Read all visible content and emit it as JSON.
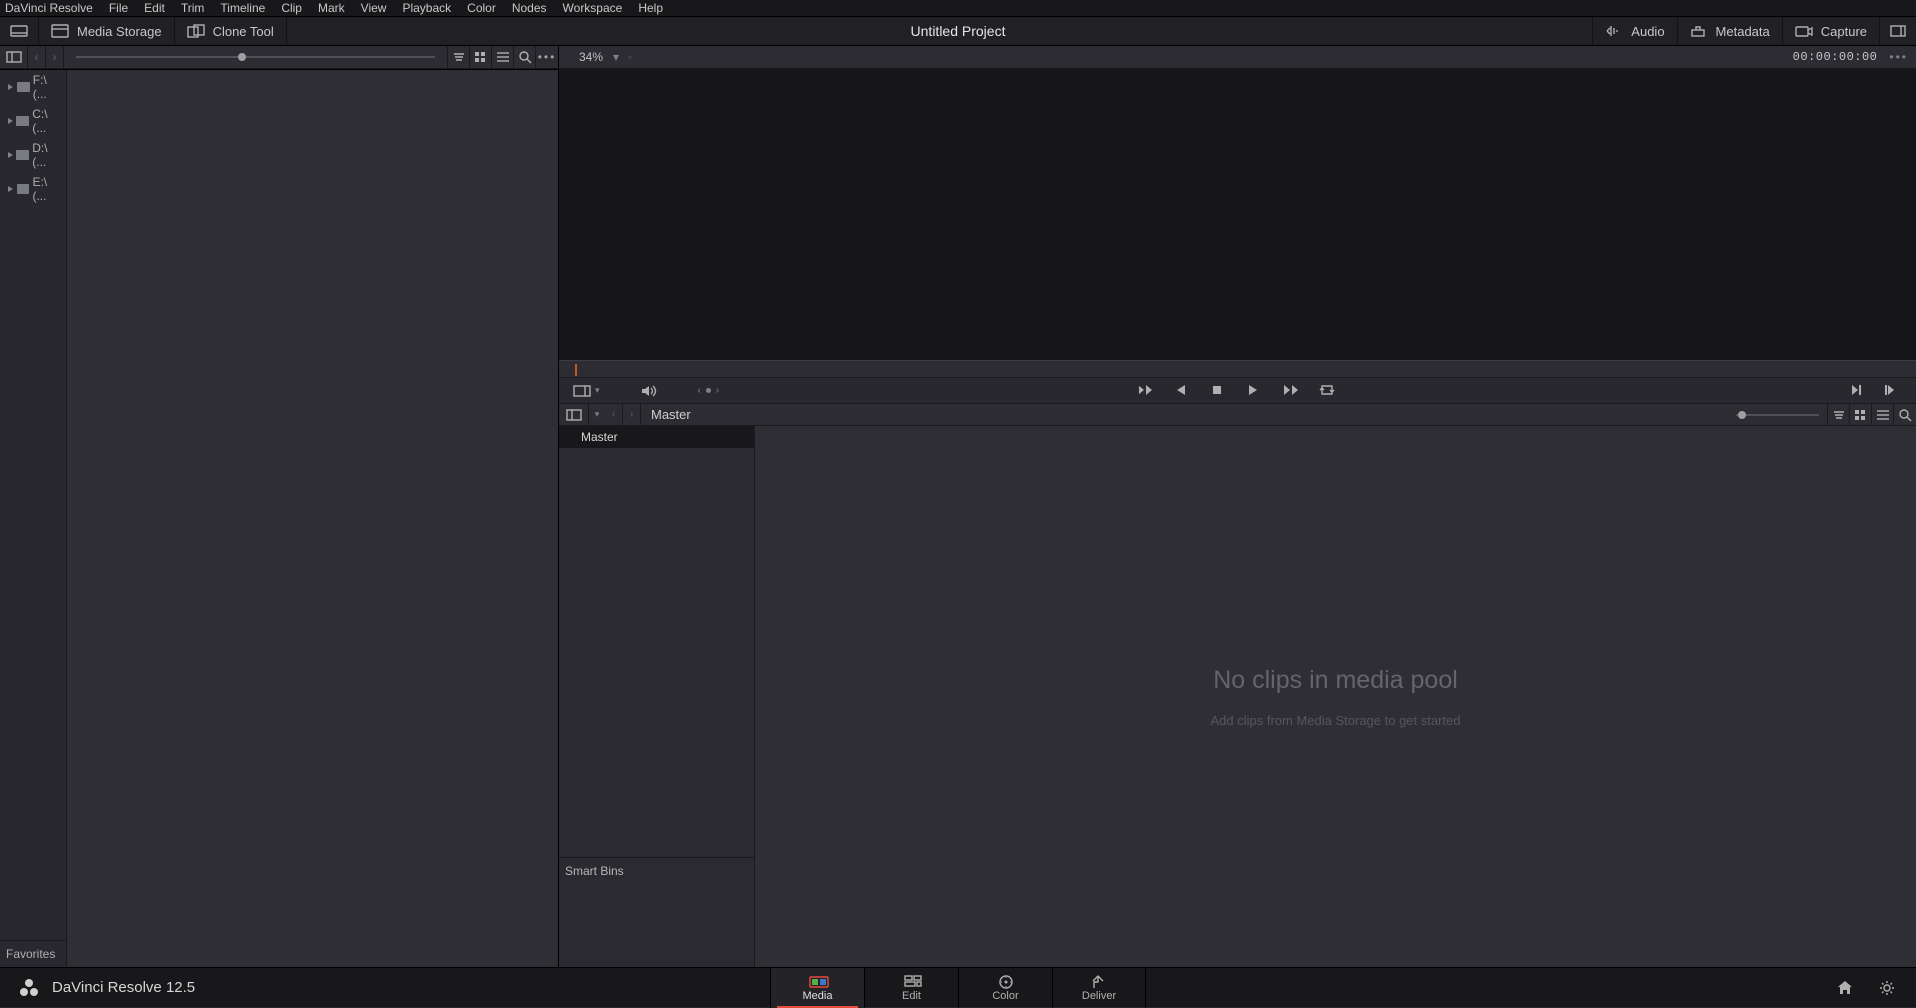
{
  "menu": [
    "DaVinci Resolve",
    "File",
    "Edit",
    "Trim",
    "Timeline",
    "Clip",
    "Mark",
    "View",
    "Playback",
    "Color",
    "Nodes",
    "Workspace",
    "Help"
  ],
  "toolbar": {
    "media_storage": "Media Storage",
    "clone_tool": "Clone Tool",
    "audio": "Audio",
    "metadata": "Metadata",
    "capture": "Capture"
  },
  "project_title": "Untitled Project",
  "drives": [
    "F:\\ (...",
    "C:\\ (...",
    "D:\\ (...",
    "E:\\ (..."
  ],
  "favorites_label": "Favorites",
  "viewer": {
    "zoom": "34%",
    "timecode": "00:00:00:00"
  },
  "pool": {
    "breadcrumb": "Master",
    "master_bin": "Master",
    "smart_bins": "Smart Bins",
    "empty_title": "No clips in media pool",
    "empty_hint": "Add clips from Media Storage to get started"
  },
  "brand": "DaVinci Resolve 12.5",
  "pages": [
    "Media",
    "Edit",
    "Color",
    "Deliver"
  ]
}
